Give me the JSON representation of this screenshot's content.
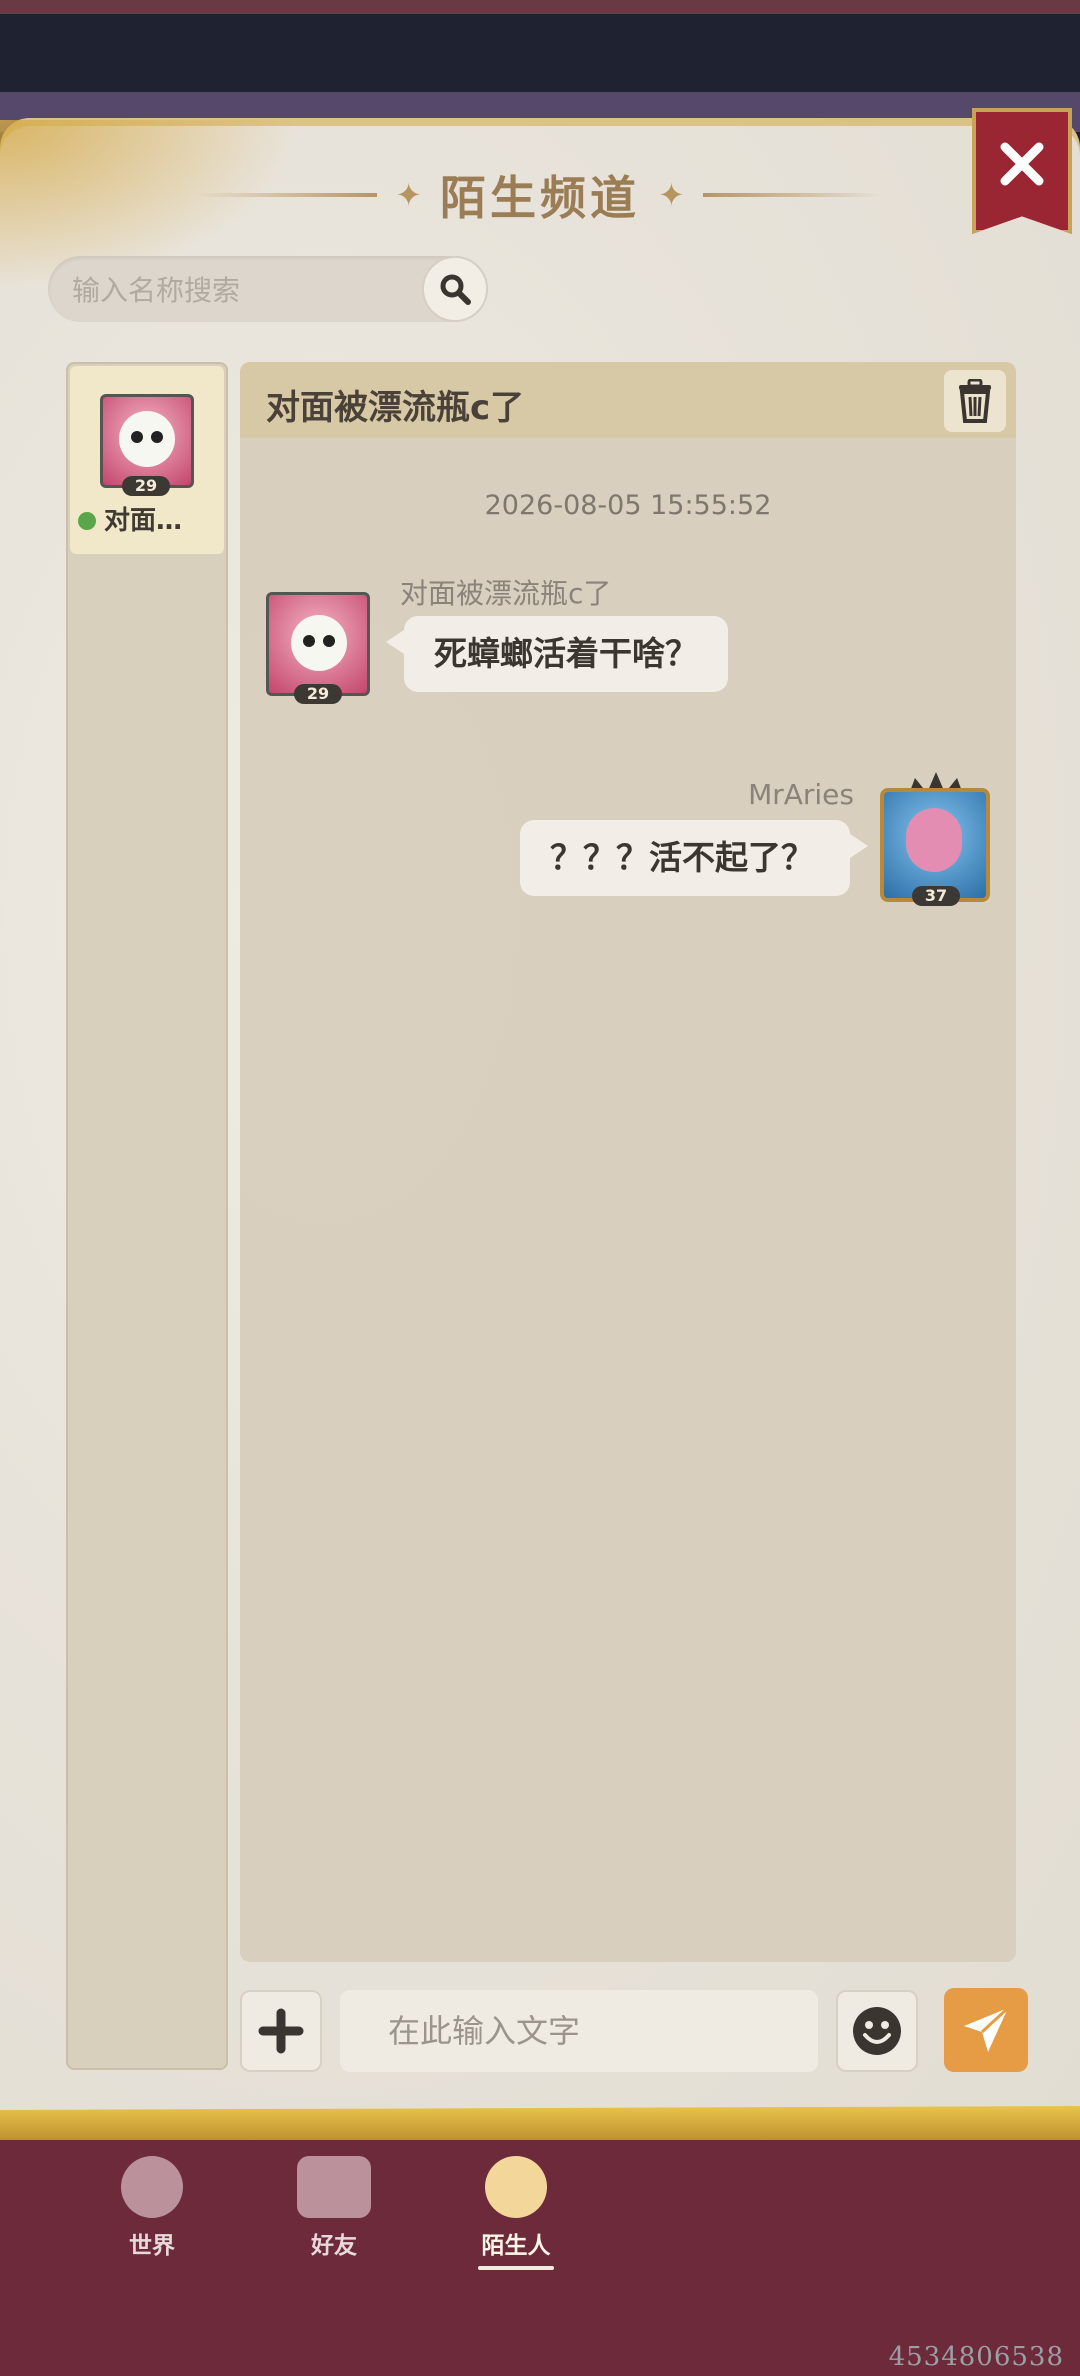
{
  "header": {
    "title": "陌生频道"
  },
  "search": {
    "placeholder": "输入名称搜索"
  },
  "contacts": [
    {
      "name": "对面…",
      "level": "29",
      "status": "online"
    }
  ],
  "chat": {
    "title": "对面被漂流瓶c了",
    "timestamp": "2026-08-05 15:55:52",
    "messages": [
      {
        "side": "left",
        "sender": "对面被漂流瓶c了",
        "level": "29",
        "text": "死蟑螂活着干啥？"
      },
      {
        "side": "right",
        "sender": "MrAries",
        "level": "37",
        "text": "？？？活不起了？"
      }
    ]
  },
  "composer": {
    "placeholder": "在此输入文字"
  },
  "bottom_nav": {
    "items": [
      {
        "label": "世界",
        "icon": "globe-icon"
      },
      {
        "label": "好友",
        "icon": "handshake-icon"
      },
      {
        "label": "陌生人",
        "icon": "stranger-hat-icon",
        "active": true
      }
    ]
  },
  "footer_id": "4534806538",
  "colors": {
    "accent_orange": "#e59c44",
    "close_red": "#9a2634",
    "nav_bg": "#6d2a3a",
    "online_green": "#5aa64a"
  }
}
